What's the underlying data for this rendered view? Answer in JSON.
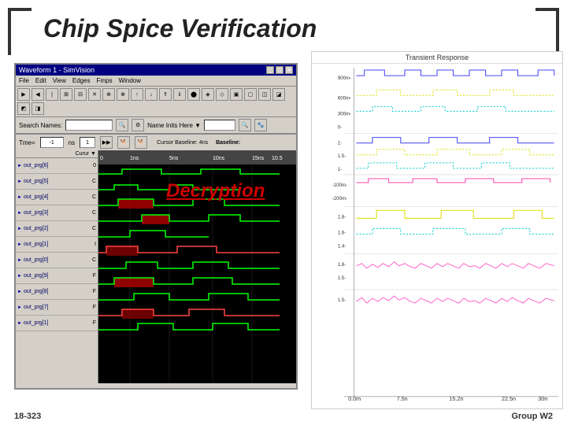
{
  "title": "Chip Spice Verification",
  "decryption_label": "Decryption",
  "sim_window": {
    "title": "Waveform 1 - SimVision",
    "menu_items": [
      "File",
      "Edit",
      "View",
      "Edges",
      "Fmps",
      "Window"
    ],
    "search_label": "Search Names:",
    "search_placeholder": "",
    "search2_label": "Name Inits Here...",
    "status": {
      "time_label": "Tme=",
      "time_value": "-1",
      "ns_label": "ns",
      "cursor_label": "Cursor Baseline: 4ns"
    },
    "signal_header": {
      "name_col": "",
      "cursor_col": "Curur ▼",
      "times": [
        "0",
        "1ns",
        "5ns",
        "10ns",
        "15ns"
      ]
    },
    "signals": [
      {
        "name": "out_prg[6]",
        "value": "0"
      },
      {
        "name": "out_prg[5]",
        "value": "C"
      },
      {
        "name": "out_prg[4]",
        "value": "C"
      },
      {
        "name": "out_prg[3]",
        "value": "C"
      },
      {
        "name": "out_prg[2]",
        "value": "C"
      },
      {
        "name": "out_prg[1]",
        "value": "I"
      },
      {
        "name": "out_prg[0]",
        "value": "C"
      },
      {
        "name": "out_prg[9]",
        "value": "F"
      },
      {
        "name": "out_prg[8]",
        "value": "F"
      },
      {
        "name": "out_prg[7]",
        "value": "F"
      },
      {
        "name": "out_prg[1]",
        "value": "F"
      }
    ]
  },
  "chart": {
    "title": "Transient Response",
    "y_labels": [
      "900m-",
      "600m-",
      "300m-",
      "0-",
      "1-",
      "1.5-",
      "1-",
      "-100m-",
      "-200m-",
      "1.8-",
      "1.6-",
      "1.4-",
      "1.8-",
      "1.5-",
      "1.5-"
    ],
    "x_labels": [
      "0.0m",
      "7.5n",
      "15.2n",
      "22.5n"
    ]
  },
  "footer": {
    "left": "18-323",
    "right": "Group W2"
  }
}
